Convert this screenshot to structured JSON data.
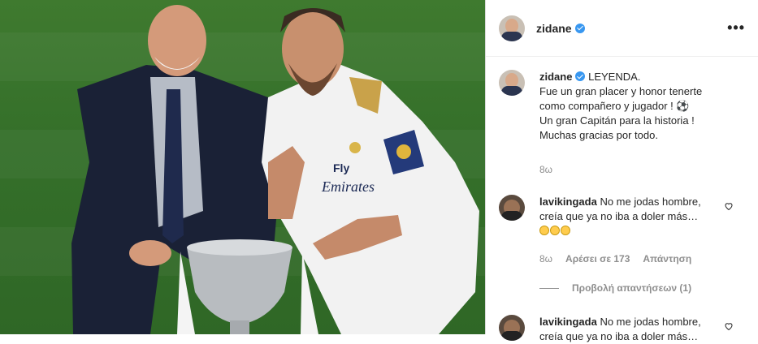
{
  "header": {
    "username": "zidane",
    "more_icon": "more-options-icon"
  },
  "caption": {
    "username": "zidane",
    "lines": [
      "LEYENDA.",
      "Fue un gran placer y honor tenerte",
      "como compañero y jugador ! ⚽",
      "Un gran Capitán para la historia !",
      "Muchas gracias por todo."
    ],
    "time": "8ω"
  },
  "comments": [
    {
      "username": "lavikingada",
      "text_line1": "No me jodas hombre,",
      "text_line2": "creía que ya no iba a doler más…",
      "time": "8ω",
      "likes": "Αρέσει σε 173",
      "reply": "Απάντηση",
      "view_replies": "Προβολή απαντήσεων (1)"
    },
    {
      "username": "lavikingada",
      "text_line1": "No me jodas hombre,",
      "text_line2": "creía que ya no iba a doler más…"
    }
  ],
  "photo": {
    "jersey_sponsor_line1": "Fly",
    "jersey_sponsor_line2": "Emirates"
  },
  "colors": {
    "verified": "#3897f0",
    "pitch": "#3a742c",
    "secondary_text": "#8e8e8e"
  }
}
